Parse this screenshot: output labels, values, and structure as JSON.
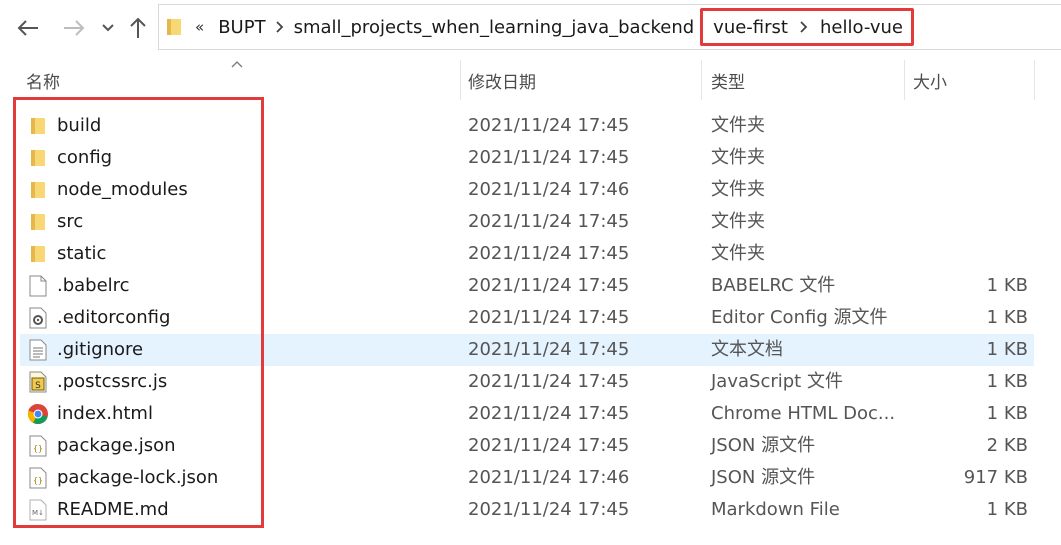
{
  "nav": {
    "back_icon": "arrow-left-icon",
    "forward_icon": "arrow-right-icon",
    "recent_icon": "chevron-down-icon",
    "up_icon": "arrow-up-icon"
  },
  "address": {
    "overflow": "«",
    "crumbs": [
      "BUPT",
      "small_projects_when_learning_java_backend",
      "vue-first",
      "hello-vue"
    ]
  },
  "columns": {
    "name": "名称",
    "date": "修改日期",
    "type": "类型",
    "size": "大小"
  },
  "files": [
    {
      "name": "build",
      "date": "2021/11/24 17:45",
      "type": "文件夹",
      "size": "",
      "icon": "folder-icon"
    },
    {
      "name": "config",
      "date": "2021/11/24 17:45",
      "type": "文件夹",
      "size": "",
      "icon": "folder-icon"
    },
    {
      "name": "node_modules",
      "date": "2021/11/24 17:46",
      "type": "文件夹",
      "size": "",
      "icon": "folder-icon"
    },
    {
      "name": "src",
      "date": "2021/11/24 17:45",
      "type": "文件夹",
      "size": "",
      "icon": "folder-icon"
    },
    {
      "name": "static",
      "date": "2021/11/24 17:45",
      "type": "文件夹",
      "size": "",
      "icon": "folder-icon"
    },
    {
      "name": ".babelrc",
      "date": "2021/11/24 17:45",
      "type": "BABELRC 文件",
      "size": "1 KB",
      "icon": "blank-file-icon"
    },
    {
      "name": ".editorconfig",
      "date": "2021/11/24 17:45",
      "type": "Editor Config 源文件",
      "size": "1 KB",
      "icon": "config-file-icon"
    },
    {
      "name": ".gitignore",
      "date": "2021/11/24 17:45",
      "type": "文本文档",
      "size": "1 KB",
      "icon": "text-file-icon"
    },
    {
      "name": ".postcssrc.js",
      "date": "2021/11/24 17:45",
      "type": "JavaScript 文件",
      "size": "1 KB",
      "icon": "script-file-icon"
    },
    {
      "name": "index.html",
      "date": "2021/11/24 17:45",
      "type": "Chrome HTML Doc...",
      "size": "1 KB",
      "icon": "chrome-icon"
    },
    {
      "name": "package.json",
      "date": "2021/11/24 17:45",
      "type": "JSON 源文件",
      "size": "2 KB",
      "icon": "json-file-icon"
    },
    {
      "name": "package-lock.json",
      "date": "2021/11/24 17:46",
      "type": "JSON 源文件",
      "size": "917 KB",
      "icon": "json-file-icon"
    },
    {
      "name": "README.md",
      "date": "2021/11/24 17:45",
      "type": "Markdown File",
      "size": "1 KB",
      "icon": "markdown-file-icon"
    }
  ],
  "selected_index": 7,
  "colors": {
    "highlight_border": "#e23b3b",
    "selection_bg": "#e5f3ff",
    "folder_yellow": "#f8d775"
  }
}
